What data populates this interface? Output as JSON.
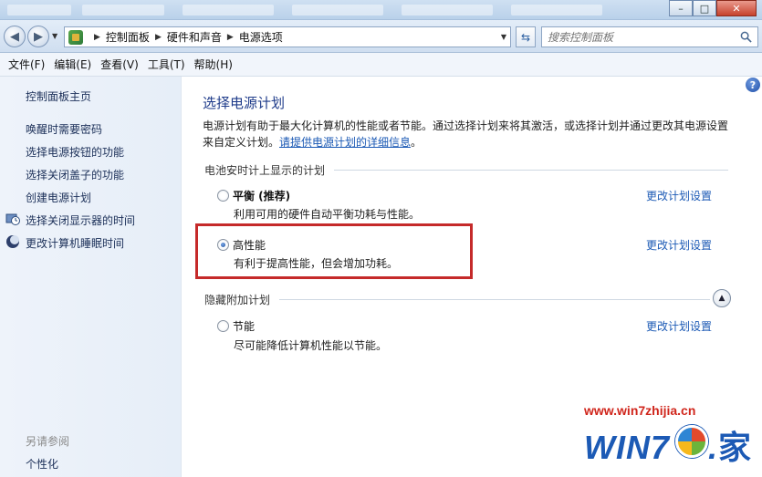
{
  "window": {
    "minimize_glyph": "–",
    "maximize_glyph": "□",
    "close_glyph": "✕"
  },
  "address_bar": {
    "breadcrumbs": [
      "控制面板",
      "硬件和声音",
      "电源选项"
    ],
    "search_placeholder": "搜索控制面板"
  },
  "menu": {
    "items": [
      "文件(F)",
      "编辑(E)",
      "查看(V)",
      "工具(T)",
      "帮助(H)"
    ]
  },
  "sidebar": {
    "home": "控制面板主页",
    "links": [
      "唤醒时需要密码",
      "选择电源按钮的功能",
      "选择关闭盖子的功能",
      "创建电源计划",
      "选择关闭显示器的时间",
      "更改计算机睡眠时间"
    ],
    "see_also_title": "另请参阅",
    "see_also_links": [
      "个性化"
    ]
  },
  "main": {
    "title": "选择电源计划",
    "description_text": "电源计划有助于最大化计算机的性能或者节能。通过选择计划来将其激活，或选择计划并通过更改其电源设置来自定义计划。",
    "description_link": "请提供电源计划的详细信息",
    "description_end": "。",
    "help_glyph": "?",
    "section_shown": "电池安时计上显示的计划",
    "section_hidden": "隐藏附加计划",
    "plans": [
      {
        "name": "平衡 (推荐)",
        "description": "利用可用的硬件自动平衡功耗与性能。",
        "link": "更改计划设置",
        "selected": false
      },
      {
        "name": "高性能",
        "description": "有利于提高性能，但会增加功耗。",
        "link": "更改计划设置",
        "selected": true
      },
      {
        "name": "节能",
        "description": "尽可能降低计算机性能以节能。",
        "link": "更改计划设置",
        "selected": false
      }
    ]
  },
  "watermark": {
    "url": "www.win7zhijia.cn",
    "logo_text": "WIN7",
    "logo_dot": ".",
    "logo_han": "家"
  },
  "colors": {
    "link": "#1c5ab5",
    "title": "#1e3b8a",
    "highlight": "#c52a2a"
  }
}
